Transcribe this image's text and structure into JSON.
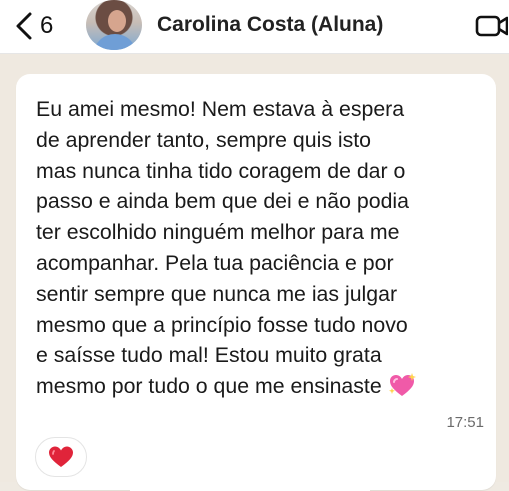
{
  "header": {
    "back_count": "6",
    "contact_name": "Carolina Costa (Aluna)"
  },
  "message": {
    "text": "Eu amei mesmo! Nem estava à espera\nde aprender tanto, sempre quis isto\nmas nunca tinha tido coragem de dar o\npasso e ainda bem que dei e não podia\nter escolhido ninguém melhor para me\nacompanhar. Pela tua paciência e por\nsentir sempre que nunca me ias julgar\nmesmo que a princípio fosse tudo novo\ne saísse tudo mal! Estou muito grata\nmesmo por tudo o que me ensinaste",
    "emoji_icon": "sparkling-heart-icon",
    "time": "17:51",
    "reaction_icon": "red-heart-icon"
  },
  "colors": {
    "bubble": "#ffffff",
    "chat_background": "#efe9e0",
    "reaction_heart": "#e0243a",
    "sparkle_heart": "#f05aa8"
  }
}
